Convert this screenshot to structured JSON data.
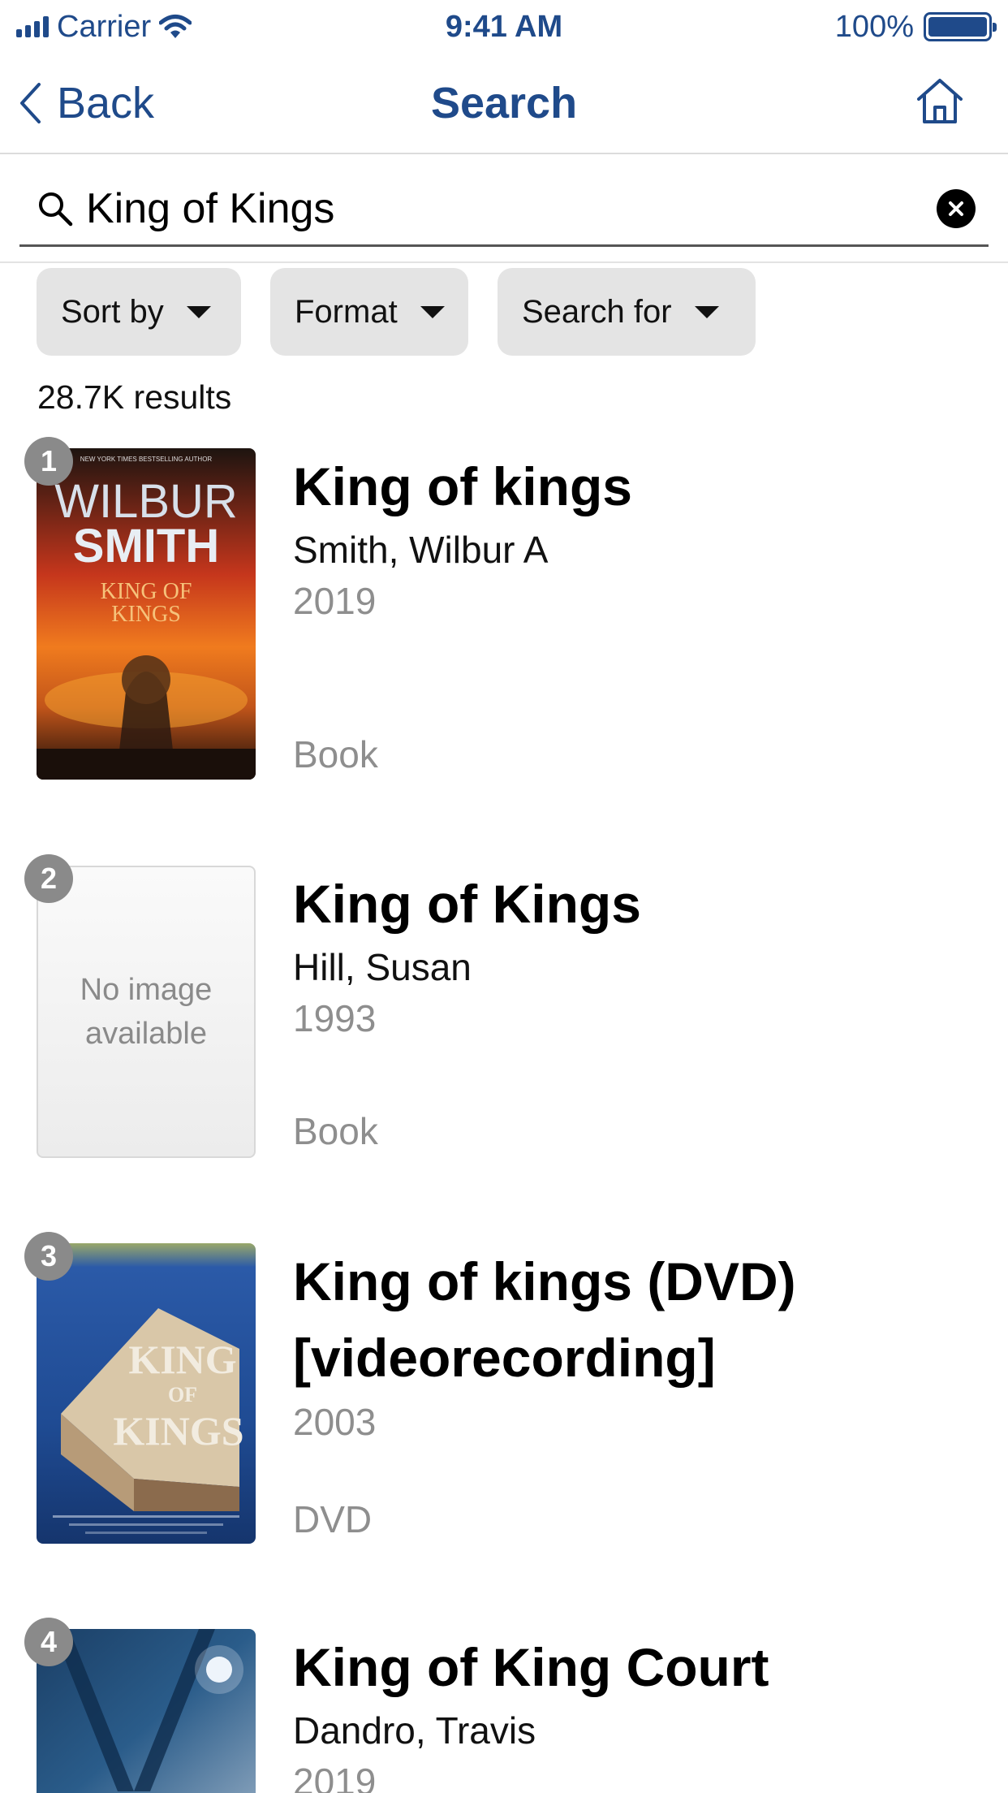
{
  "status_bar": {
    "carrier": "Carrier",
    "time": "9:41 AM",
    "battery": "100%"
  },
  "nav": {
    "back_label": "Back",
    "title": "Search"
  },
  "search": {
    "query": "King of Kings"
  },
  "filters": [
    {
      "label": "Sort by"
    },
    {
      "label": "Format"
    },
    {
      "label": "Search for"
    }
  ],
  "result_count": "28.7K results",
  "results": [
    {
      "rank": "1",
      "title": "King of kings",
      "author": "Smith, Wilbur A",
      "year": "2019",
      "format": "Book",
      "cover_text": {
        "top": "NEW YORK TIMES BESTSELLING AUTHOR",
        "line1": "WILBUR",
        "line2": "SMITH",
        "line3": "KING OF",
        "line4": "KINGS"
      }
    },
    {
      "rank": "2",
      "title": "King of Kings",
      "author": "Hill, Susan",
      "year": "1993",
      "format": "Book",
      "no_image_line1": "No image",
      "no_image_line2": "available"
    },
    {
      "rank": "3",
      "title": "King of kings (DVD) [videorecording]",
      "year": "2003",
      "format": "DVD",
      "cover_text": {
        "line1": "KING",
        "line2": "OF",
        "line3": "KINGS"
      }
    },
    {
      "rank": "4",
      "title": "King of King Court",
      "author": "Dandro, Travis",
      "year": "2019"
    }
  ],
  "colors": {
    "accent": "#1f4a8a",
    "badge": "#8a8a8a",
    "filter_bg": "#e4e4e4",
    "muted_text": "#8e8e8e"
  }
}
